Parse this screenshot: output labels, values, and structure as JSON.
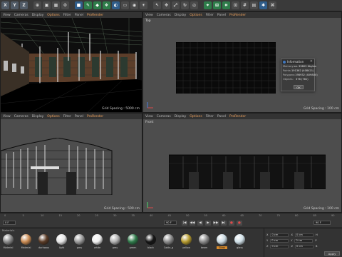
{
  "toolbar": {
    "xyz": [
      "X",
      "Y",
      "Z"
    ],
    "icons": [
      "undo-icon",
      "redo-icon",
      "select-icon",
      "move-icon",
      "scale-icon",
      "rotate-icon",
      "coords-icon",
      "render-icon",
      "cube-icon",
      "pen-icon",
      "subdivide-icon",
      "array-icon",
      "camera-icon",
      "light-icon",
      "lock-icon"
    ]
  },
  "viewports": {
    "menu": [
      "View",
      "Cameras",
      "Display",
      "Options",
      "Filter",
      "Panel",
      "ProRender"
    ],
    "highlight": [
      "Options",
      "ProRender"
    ],
    "perspective": {
      "grid_spacing": "Grid Spacing : 5000 cm"
    },
    "top": {
      "label": "Top",
      "grid_spacing": "Grid Spacing : 100 cm"
    },
    "right": {
      "grid_spacing": "Grid Spacing : 500 cm"
    },
    "front": {
      "label": "Front",
      "grid_spacing": "Grid Spacing : 100 cm"
    }
  },
  "info": {
    "title": "Information",
    "rows": [
      {
        "k": "Memory:",
        "v": "ca. 39803 Kbytes"
      },
      {
        "k": "Points:",
        "v": "191362 (408421)"
      },
      {
        "k": "Polygons:",
        "v": "198932 (409800)"
      },
      {
        "k": "Objects:",
        "v": "376 (781)"
      }
    ],
    "ok": "OK"
  },
  "timeline": {
    "ticks": [
      "0",
      "5",
      "10",
      "15",
      "20",
      "25",
      "30",
      "35",
      "40",
      "45",
      "50",
      "55",
      "60",
      "65",
      "70",
      "75",
      "80",
      "85",
      "90"
    ],
    "start": "0 F",
    "end": "90 F",
    "current": "90 F",
    "transport": [
      "|◀",
      "◀◀",
      "◀",
      "▶",
      "▶▶",
      "▶|",
      "●",
      "●"
    ]
  },
  "materials": {
    "header": "Materials",
    "items": [
      {
        "label": "Material",
        "color": "#8a8a8a"
      },
      {
        "label": "Material",
        "color": "#c98a52"
      },
      {
        "label": "darkwood",
        "color": "#5a3b26"
      },
      {
        "label": "light",
        "color": "#e4e4e4"
      },
      {
        "label": "grey",
        "color": "#9a9a9a"
      },
      {
        "label": "white",
        "color": "#f0f0f0"
      },
      {
        "label": "grey",
        "color": "#b0b0b0"
      },
      {
        "label": "green",
        "color": "#2f7a4a"
      },
      {
        "label": "black",
        "color": "#151515"
      },
      {
        "label": "Cable_g",
        "color": "#8a8a8a"
      },
      {
        "label": "yellow",
        "color": "#b59a2e"
      },
      {
        "label": "beam",
        "color": "#8a8a8a"
      },
      {
        "label": "Glass",
        "color": "#c8d8e0"
      },
      {
        "label": "glass",
        "color": "#d0e0e8"
      }
    ],
    "selected_index": 12
  },
  "coords": {
    "rows": [
      [
        "X",
        "0 cm",
        "X",
        "0 cm",
        "H",
        "0°"
      ],
      [
        "Y",
        "0 cm",
        "Y",
        "0 cm",
        "P",
        "0°"
      ],
      [
        "Z",
        "0 cm",
        "Z",
        "0 cm",
        "B",
        "0°"
      ]
    ],
    "apply": "Apply"
  }
}
